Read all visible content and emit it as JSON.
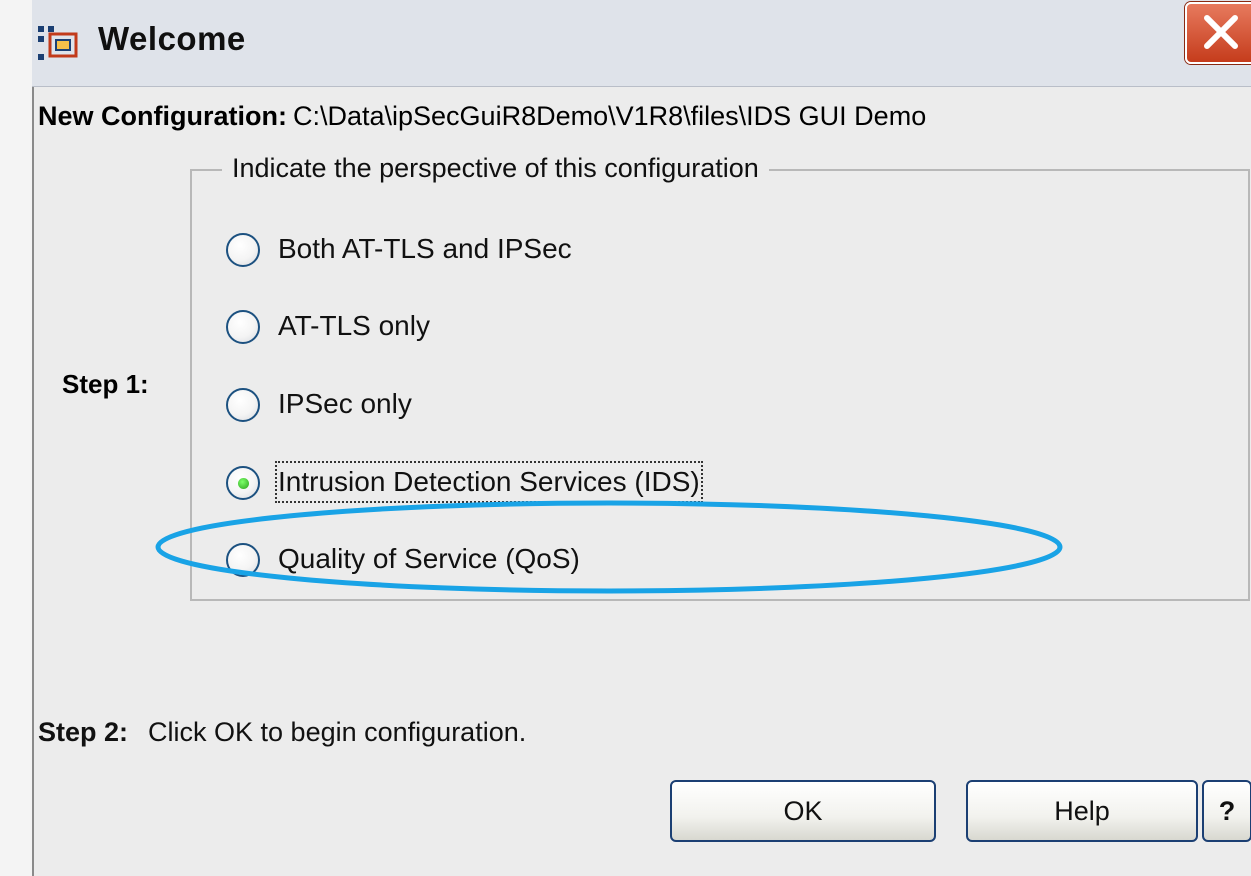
{
  "window": {
    "title": "Welcome",
    "app_icon": "configuration-app-icon",
    "close_icon": "close-icon"
  },
  "config": {
    "label": "New Configuration:",
    "path": "C:\\Data\\ipSecGuiR8Demo\\V1R8\\files\\IDS GUI Demo"
  },
  "step1": {
    "label": "Step 1:",
    "group_title": "Indicate the perspective of this configuration",
    "options": [
      {
        "label": "Both AT-TLS and IPSec",
        "selected": false
      },
      {
        "label": "AT-TLS only",
        "selected": false
      },
      {
        "label": "IPSec only",
        "selected": false
      },
      {
        "label": "Intrusion Detection Services (IDS)",
        "selected": true
      },
      {
        "label": "Quality of Service (QoS)",
        "selected": false
      }
    ]
  },
  "step2": {
    "label": "Step 2:",
    "text": "Click OK to begin configuration."
  },
  "buttons": {
    "ok": "OK",
    "help": "Help",
    "context_help": "?"
  },
  "colors": {
    "highlight_ellipse": "#19a3e6",
    "radio_border": "#1c5180",
    "radio_selected_dot": "#34b325",
    "button_border": "#1b3f73",
    "close_button": "#c53c1c"
  }
}
